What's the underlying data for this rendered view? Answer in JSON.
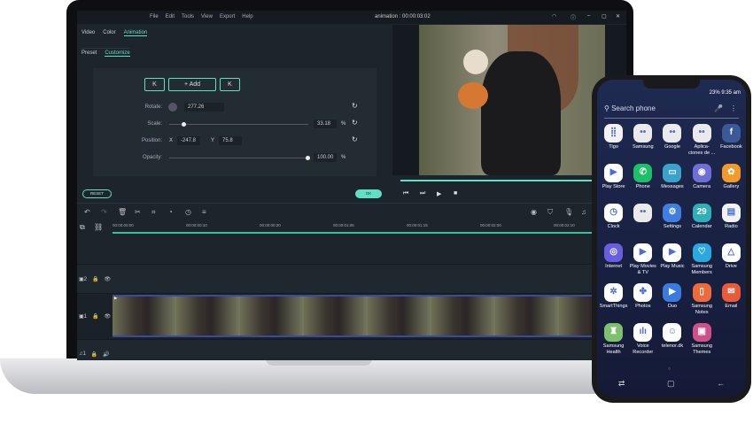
{
  "editor": {
    "menu": [
      "File",
      "Edit",
      "Tools",
      "View",
      "Export",
      "Help"
    ],
    "title": "animation : 00:00:03:02",
    "tabs": [
      "Video",
      "Color",
      "Animation"
    ],
    "subtabs": [
      "Preset",
      "Customize"
    ],
    "keyframe": {
      "prev": "K",
      "add": "+ Add",
      "next": "K"
    },
    "rotate": {
      "label": "Rotate:",
      "value": "277.26"
    },
    "scale": {
      "label": "Scale:",
      "value": "33.18",
      "unit": "%",
      "fraction": 0.1
    },
    "position": {
      "label": "Position:",
      "x_label": "X",
      "x": "-247.8",
      "y_label": "Y",
      "y": "75.8"
    },
    "opacity": {
      "label": "Opacity:",
      "value": "100.00",
      "unit": "%",
      "fraction": 1.0
    },
    "reset": "RESET",
    "ok": "OK",
    "ruler": [
      "00:00:00:00",
      "00:00:00:10",
      "00:00:00:20",
      "00:00:01:05",
      "00:00:01:15",
      "00:00:02:00",
      "00:00:02:10"
    ],
    "tracks": [
      "2",
      "1",
      "1"
    ],
    "accent": "#5fe0c2"
  },
  "phone": {
    "status": "23% 9:35 am",
    "search_placeholder": "Search phone",
    "apps": [
      {
        "label": "Tigo",
        "color": "#f2f2f2",
        "glyph": "⣿"
      },
      {
        "label": "Samsung",
        "color": "#eaeaea",
        "glyph": "••"
      },
      {
        "label": "Google",
        "color": "#eaeaea",
        "glyph": "••"
      },
      {
        "label": "Aplica-ciones de ...",
        "color": "#eaeaea",
        "glyph": "••"
      },
      {
        "label": "Facebook",
        "color": "#3b5998",
        "glyph": "f"
      },
      {
        "label": "Play Store",
        "color": "#ffffff",
        "glyph": "▶"
      },
      {
        "label": "Phone",
        "color": "#1fbf6a",
        "glyph": "✆"
      },
      {
        "label": "Messages",
        "color": "#3aa3c9",
        "glyph": "▭"
      },
      {
        "label": "Camera",
        "color": "#6d6fd6",
        "glyph": "◉"
      },
      {
        "label": "Gallery",
        "color": "#f29a28",
        "glyph": "✿"
      },
      {
        "label": "Clock",
        "color": "#ffffff",
        "glyph": "◷"
      },
      {
        "label": "",
        "color": "#eaeaea",
        "glyph": "••"
      },
      {
        "label": "Settings",
        "color": "#3f7fe0",
        "glyph": "⚙"
      },
      {
        "label": "Calendar",
        "color": "#2fb0b8",
        "glyph": "29"
      },
      {
        "label": "Radio",
        "color": "#f2f2f2",
        "glyph": "▤"
      },
      {
        "label": "Internet",
        "color": "#6a5ee0",
        "glyph": "◎"
      },
      {
        "label": "Play Movies & TV",
        "color": "#ffffff",
        "glyph": "▶"
      },
      {
        "label": "Play Music",
        "color": "#ffffff",
        "glyph": "▶"
      },
      {
        "label": "Samsung Members",
        "color": "#29a9e0",
        "glyph": "♡"
      },
      {
        "label": "Drive",
        "color": "#ffffff",
        "glyph": "△"
      },
      {
        "label": "SmartThings",
        "color": "#ffffff",
        "glyph": "✲"
      },
      {
        "label": "Photos",
        "color": "#ffffff",
        "glyph": "✤"
      },
      {
        "label": "Duo",
        "color": "#3a7be0",
        "glyph": "▶"
      },
      {
        "label": "Samsung Notes",
        "color": "#ef6a3a",
        "glyph": "▯"
      },
      {
        "label": "Email",
        "color": "#ea5a3a",
        "glyph": "✉"
      },
      {
        "label": "Samsung Health",
        "color": "#7fc070",
        "glyph": "♜"
      },
      {
        "label": "Voice Recorder",
        "color": "#ffffff",
        "glyph": "ılı"
      },
      {
        "label": "telenor.dk",
        "color": "#ffffff",
        "glyph": "☺"
      },
      {
        "label": "Samsung Themes",
        "color": "#d0508a",
        "glyph": "▣"
      }
    ],
    "nav": [
      "⇄",
      "▢",
      "←"
    ]
  }
}
